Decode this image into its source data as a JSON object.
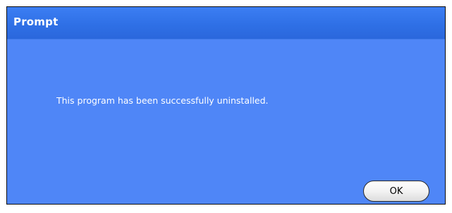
{
  "dialog": {
    "title": "Prompt",
    "message": "This program has been successfully uninstalled.",
    "ok_label": "OK"
  },
  "colors": {
    "title_bar": "#2f70e6",
    "body": "#4f86f7",
    "text": "#ffffff",
    "button_face": "#f3f3f3"
  }
}
